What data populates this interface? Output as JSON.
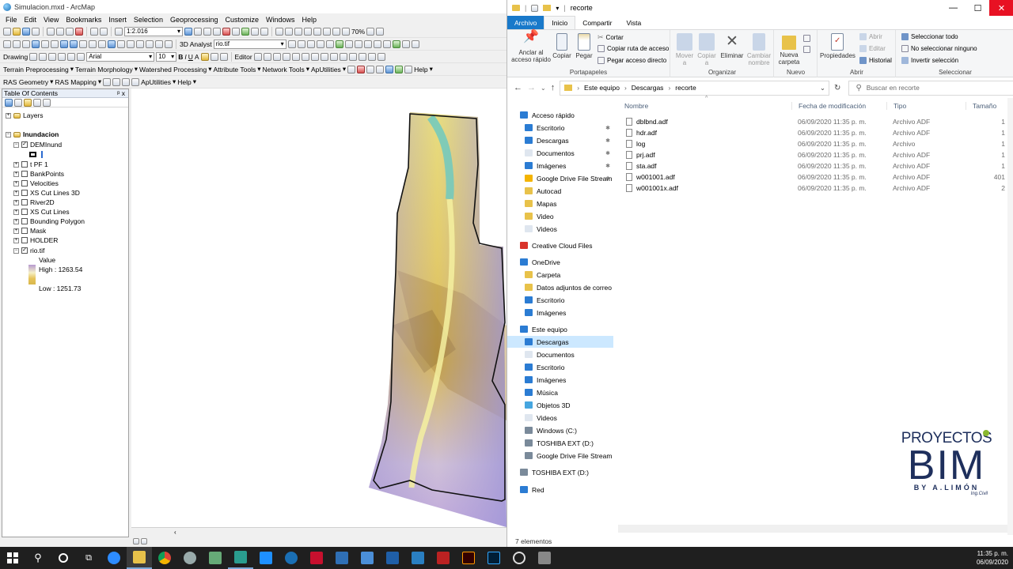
{
  "arcmap": {
    "title": "Simulacion.mxd - ArcMap",
    "menu": [
      "File",
      "Edit",
      "View",
      "Bookmarks",
      "Insert",
      "Selection",
      "Geoprocessing",
      "Customize",
      "Windows",
      "Help"
    ],
    "scale": "1:2.016",
    "analyst_label": "3D Analyst",
    "layer_combo": "rio.tif",
    "zoom_level": "70%",
    "drawing_label": "Drawing",
    "font_name": "Arial",
    "font_size": "10",
    "editor_label": "Editor",
    "toolbar3": [
      "Terrain Preprocessing",
      "Terrain Morphology",
      "Watershed Processing",
      "Attribute Tools",
      "Network Tools",
      "ApUtilities",
      "Help"
    ],
    "toolbar4": [
      "RAS Geometry",
      "RAS Mapping",
      "ApUtilities",
      "Help"
    ],
    "toc": {
      "title": "Table Of Contents",
      "pin": "ᵖ x",
      "layers_root": "Layers",
      "frame": "Inundacion",
      "items": [
        "DEMInund",
        "t PF 1",
        "BankPoints",
        "Velocities",
        "XS Cut Lines 3D",
        "River2D",
        "XS Cut Lines",
        "Bounding Polygon",
        "Mask",
        "HOLDER",
        "rio.tif"
      ],
      "legend_value": "Value",
      "legend_high": "High : 1263.54",
      "legend_low": "Low : 1251.73"
    }
  },
  "explorer": {
    "title": "recorte",
    "tabs": [
      "Archivo",
      "Inicio",
      "Compartir",
      "Vista"
    ],
    "ribbon": {
      "pin_quick": "Anclar al acceso rápido",
      "copy": "Copiar",
      "paste": "Pegar",
      "cut": "Cortar",
      "copy_path": "Copiar ruta de acceso",
      "paste_shortcut": "Pegar acceso directo",
      "group_clipboard": "Portapapeles",
      "move_to": "Mover a",
      "copy_to": "Copiar a",
      "delete": "Eliminar",
      "rename": "Cambiar nombre",
      "group_organize": "Organizar",
      "new_folder": "Nueva carpeta",
      "group_new": "Nuevo",
      "properties": "Propiedades",
      "open": "Abrir",
      "edit": "Editar",
      "history": "Historial",
      "group_open": "Abrir",
      "select_all": "Seleccionar todo",
      "select_none": "No seleccionar ninguno",
      "invert_selection": "Invertir selección",
      "group_select": "Seleccionar"
    },
    "breadcrumb": [
      "Este equipo",
      "Descargas",
      "recorte"
    ],
    "search_placeholder": "Buscar en recorte",
    "nav": {
      "quick_access": "Acceso rápido",
      "quick_items": [
        "Escritorio",
        "Descargas",
        "Documentos",
        "Imágenes",
        "Google Drive File Stream",
        "Autocad",
        "Mapas",
        "Video",
        "Videos"
      ],
      "creative_cloud": "Creative Cloud Files",
      "onedrive": "OneDrive",
      "onedrive_items": [
        "Carpeta",
        "Datos adjuntos de correo ele",
        "Escritorio",
        "Imágenes"
      ],
      "this_pc": "Este equipo",
      "pc_items": [
        "Descargas",
        "Documentos",
        "Escritorio",
        "Imágenes",
        "Música",
        "Objetos 3D",
        "Videos",
        "Windows (C:)",
        "TOSHIBA EXT (D:)",
        "Google Drive File Stream (G:"
      ],
      "toshiba": "TOSHIBA EXT (D:)",
      "network": "Red"
    },
    "columns": [
      "Nombre",
      "Fecha de modificación",
      "Tipo",
      "Tamaño"
    ],
    "files": [
      {
        "name": "dblbnd.adf",
        "date": "06/09/2020 11:35 p. m.",
        "type": "Archivo ADF",
        "size": "1 K"
      },
      {
        "name": "hdr.adf",
        "date": "06/09/2020 11:35 p. m.",
        "type": "Archivo ADF",
        "size": "1 K"
      },
      {
        "name": "log",
        "date": "06/09/2020 11:35 p. m.",
        "type": "Archivo",
        "size": "1 K"
      },
      {
        "name": "prj.adf",
        "date": "06/09/2020 11:35 p. m.",
        "type": "Archivo ADF",
        "size": "1 K"
      },
      {
        "name": "sta.adf",
        "date": "06/09/2020 11:35 p. m.",
        "type": "Archivo ADF",
        "size": "1 K"
      },
      {
        "name": "w001001.adf",
        "date": "06/09/2020 11:35 p. m.",
        "type": "Archivo ADF",
        "size": "401 K"
      },
      {
        "name": "w001001x.adf",
        "date": "06/09/2020 11:35 p. m.",
        "type": "Archivo ADF",
        "size": "2 K"
      }
    ],
    "status": "7 elementos"
  },
  "logo": {
    "line1": "PROYECTOS",
    "line2": "BIM",
    "line3": "BY A.LIMÓN",
    "line4": "Ing.Civil"
  },
  "taskbar": {
    "time": "11:35 p. m.",
    "date": "06/09/2020"
  },
  "colors": {
    "accent": "#1979ca",
    "archivo_tab": "#1979ca",
    "selected_nav": "#cce8ff",
    "logo": "#1e2f5c"
  }
}
